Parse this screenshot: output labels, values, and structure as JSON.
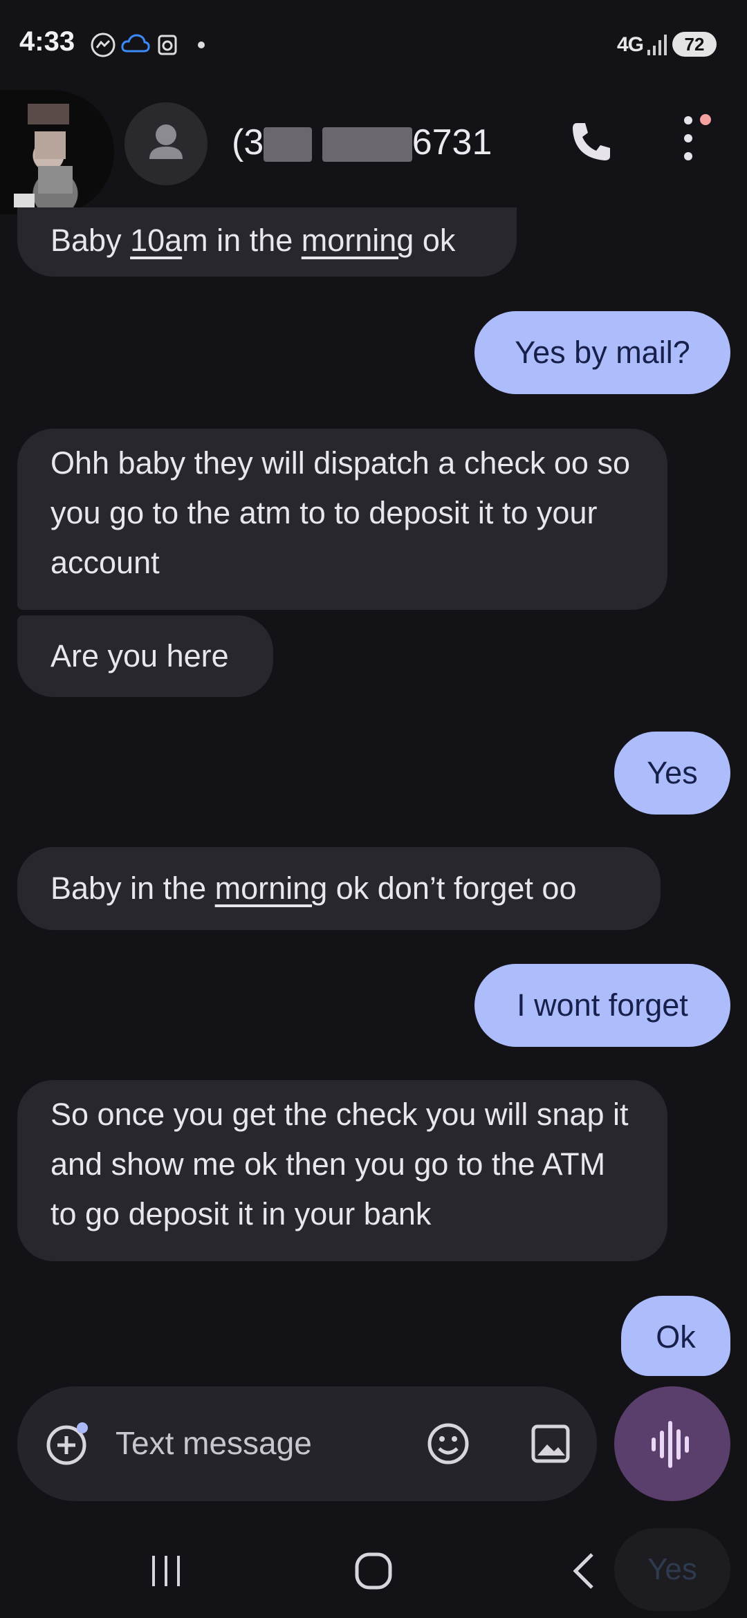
{
  "status_bar": {
    "time": "4:33",
    "network": "4G",
    "battery": "72",
    "icons": [
      "messenger-icon",
      "cloud-icon",
      "app-notification-icon",
      "dot-icon",
      "signal-icon"
    ]
  },
  "header": {
    "contact_name_visible": "(3",
    "contact_name_end": "6731",
    "icons": [
      "person-icon",
      "phone-icon",
      "more-vert-icon"
    ]
  },
  "messages": [
    {
      "direction": "incoming",
      "parts": [
        {
          "t": "Baby "
        },
        {
          "t": "10a",
          "u": true
        },
        {
          "t": "m in the "
        },
        {
          "t": "morning",
          "u": true
        },
        {
          "t": " ok"
        }
      ]
    },
    {
      "direction": "outgoing",
      "text": "Yes by mail?"
    },
    {
      "direction": "incoming",
      "text": "Ohh baby they will dispatch a check oo so you go to the atm to to deposit it to your account"
    },
    {
      "direction": "incoming",
      "text": "Are you here"
    },
    {
      "direction": "outgoing",
      "text": "Yes"
    },
    {
      "direction": "incoming",
      "parts": [
        {
          "t": "Baby in the "
        },
        {
          "t": "morning",
          "u": true
        },
        {
          "t": " ok don’t forget oo"
        }
      ]
    },
    {
      "direction": "outgoing",
      "text": "I wont forget"
    },
    {
      "direction": "incoming",
      "text": "So once you get the check you will snap it and show me ok then you go to the ATM to go deposit it in your bank"
    },
    {
      "direction": "outgoing",
      "text": "Ok"
    }
  ],
  "composer": {
    "placeholder": "Text message",
    "icons": [
      "add-icon",
      "emoji-icon",
      "image-icon",
      "voice-icon"
    ]
  },
  "nav": {
    "ghost_text": "Yes",
    "icons": [
      "recent-apps-icon",
      "home-icon",
      "back-icon"
    ]
  },
  "colors": {
    "background": "#131217",
    "incoming_bubble": "#28272d",
    "outgoing_bubble": "#adbcfb",
    "voice_button": "#5a3f6d"
  }
}
